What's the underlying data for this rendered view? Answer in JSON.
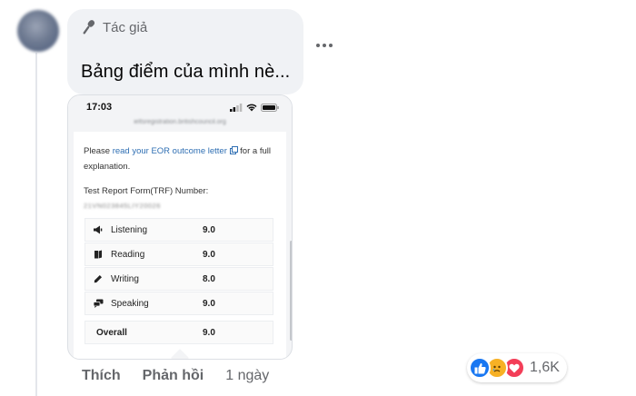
{
  "comment": {
    "author_badge": "Tác giả",
    "text": "Bảng điểm của mình nè..."
  },
  "screenshot": {
    "status_time": "17:03",
    "url": "ieltsregistration.britishcouncil.org",
    "intro_before": "Please ",
    "intro_link": "read your EOR outcome letter",
    "intro_after": " for a full explanation.",
    "trf_label": "Test Report Form(TRF) Number:",
    "trf_value": "21VN023845LIY20026",
    "scores": [
      {
        "name": "Listening",
        "score": "9.0",
        "icon": "speaker-icon"
      },
      {
        "name": "Reading",
        "score": "9.0",
        "icon": "book-icon"
      },
      {
        "name": "Writing",
        "score": "8.0",
        "icon": "pencil-icon"
      },
      {
        "name": "Speaking",
        "score": "9.0",
        "icon": "speech-bubble-icon"
      }
    ],
    "overall_label": "Overall",
    "overall_score": "9.0"
  },
  "actions": {
    "like": "Thích",
    "reply": "Phản hồi",
    "timestamp": "1 ngày"
  },
  "reactions": {
    "types": [
      "like",
      "sad",
      "love"
    ],
    "count": "1,6K"
  },
  "colors": {
    "bubble": "#f0f2f5",
    "link": "#2f6fb3",
    "like": "#1877f2",
    "love": "#f33e58",
    "sad": "#f7b125"
  }
}
